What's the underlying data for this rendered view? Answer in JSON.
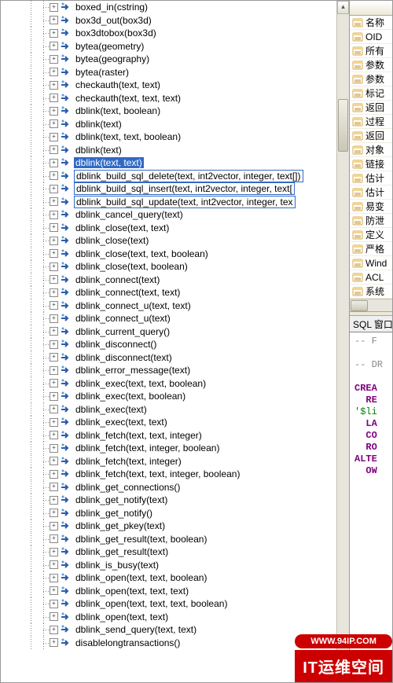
{
  "tree": {
    "selected_index": 13,
    "boxed_indices": [
      14,
      15,
      16
    ],
    "items": [
      "boxed_in(cstring)",
      "box3d_out(box3d)",
      "box3dtobox(box3d)",
      "bytea(geometry)",
      "bytea(geography)",
      "bytea(raster)",
      "checkauth(text, text)",
      "checkauth(text, text, text)",
      "dblink(text, boolean)",
      "dblink(text)",
      "dblink(text, text, boolean)",
      "dblink(text)",
      "dblink(text, text)",
      "dblink_build_sql_delete(text, int2vector, integer, text[])",
      "dblink_build_sql_insert(text, int2vector, integer, text[",
      "dblink_build_sql_update(text, int2vector, integer, tex",
      "dblink_cancel_query(text)",
      "dblink_close(text, text)",
      "dblink_close(text)",
      "dblink_close(text, text, boolean)",
      "dblink_close(text, boolean)",
      "dblink_connect(text)",
      "dblink_connect(text, text)",
      "dblink_connect_u(text, text)",
      "dblink_connect_u(text)",
      "dblink_current_query()",
      "dblink_disconnect()",
      "dblink_disconnect(text)",
      "dblink_error_message(text)",
      "dblink_exec(text, text, boolean)",
      "dblink_exec(text, boolean)",
      "dblink_exec(text)",
      "dblink_exec(text, text)",
      "dblink_fetch(text, text, integer)",
      "dblink_fetch(text, integer, boolean)",
      "dblink_fetch(text, integer)",
      "dblink_fetch(text, text, integer, boolean)",
      "dblink_get_connections()",
      "dblink_get_notify(text)",
      "dblink_get_notify()",
      "dblink_get_pkey(text)",
      "dblink_get_result(text, boolean)",
      "dblink_get_result(text)",
      "dblink_is_busy(text)",
      "dblink_open(text, text, boolean)",
      "dblink_open(text, text, text)",
      "dblink_open(text, text, text, boolean)",
      "dblink_open(text, text)",
      "dblink_send_query(text, text)",
      "disablelongtransactions()"
    ]
  },
  "properties": {
    "items": [
      "名称",
      "OID",
      "所有",
      "参数",
      "参数",
      "标记",
      "返回",
      "过程",
      "返回",
      "对象",
      "链接",
      "估计",
      "估计",
      "易变",
      "防泄",
      "定义",
      "严格",
      "Wind",
      "ACL",
      "系统"
    ]
  },
  "sql": {
    "header": "SQL 窗口",
    "lines": [
      {
        "cls": "sql-comment",
        "text": "-- F"
      },
      {
        "cls": "",
        "text": ""
      },
      {
        "cls": "sql-comment",
        "text": "-- DR"
      },
      {
        "cls": "",
        "text": ""
      },
      {
        "cls": "sql-kw",
        "text": "CREA"
      },
      {
        "cls": "sql-kw",
        "text": "  RE"
      },
      {
        "cls": "sql-str",
        "text": "'$li"
      },
      {
        "cls": "sql-kw",
        "text": "  LA"
      },
      {
        "cls": "sql-kw",
        "text": "  CO"
      },
      {
        "cls": "sql-kw",
        "text": "  RO"
      },
      {
        "cls": "sql-kw",
        "text": "ALTE"
      },
      {
        "cls": "sql-kw",
        "text": "  OW"
      }
    ]
  },
  "watermark": {
    "url": "WWW.94IP.COM",
    "title": "IT运维空间"
  },
  "scroll": {
    "up": "▴",
    "down": "▾"
  }
}
